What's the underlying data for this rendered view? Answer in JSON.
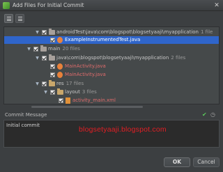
{
  "window": {
    "title": "Add Files For Initial Commit"
  },
  "tree": {
    "rows": [
      {
        "path": "androidTest\\java\\com\\blogspot\\blogsetyaaji\\myapplication",
        "count": "1 file"
      },
      {
        "name": "ExampleInstrumentedTest.java"
      },
      {
        "path": "main",
        "count": "20 files"
      },
      {
        "path": "java\\com\\blogspot\\blogsetyaaji\\myapplication",
        "count": "2 files"
      },
      {
        "name": "MainActivity.java"
      },
      {
        "name": "MainActivity.java"
      },
      {
        "path": "res",
        "count": "17 files"
      },
      {
        "path": "layout",
        "count": "3 files"
      },
      {
        "name": "activity_main.xml"
      }
    ]
  },
  "commit": {
    "header": "Commit Message",
    "message": "Initial commit",
    "watermark": "blogsetyaaji.blogspot.com"
  },
  "buttons": {
    "ok": "OK",
    "cancel": "Cancel"
  },
  "colors": {
    "selection": "#2f65ca",
    "accent_red": "#e06c6c",
    "watermark": "#e31e24"
  }
}
